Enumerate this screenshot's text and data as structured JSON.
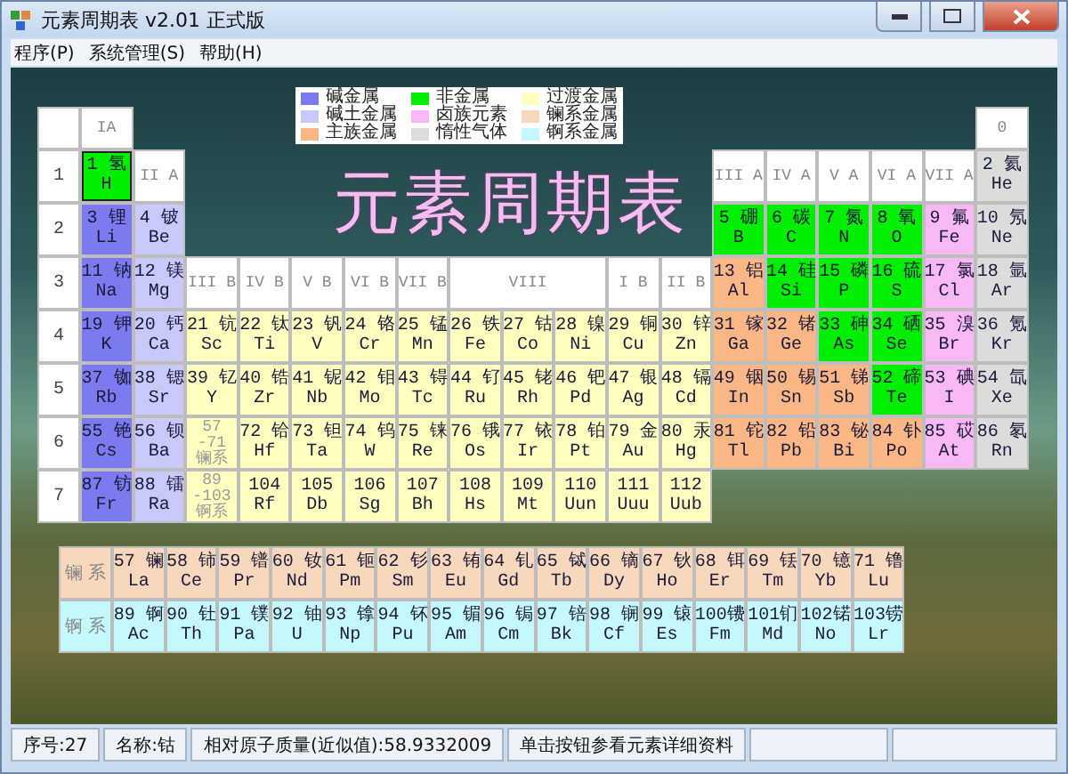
{
  "window": {
    "title": "元素周期表 v2.01 正式版"
  },
  "menu": [
    "程序(P)",
    "系统管理(S)",
    "帮助(H)"
  ],
  "legend": [
    {
      "label": "碱金属",
      "kind": "alkali",
      "color": "#7b7bef"
    },
    {
      "label": "碱土金属",
      "kind": "alkaline",
      "color": "#c8c8fa"
    },
    {
      "label": "主族金属",
      "kind": "poor",
      "color": "#fbb685"
    },
    {
      "label": "非金属",
      "kind": "nonmetal",
      "color": "#00ee00"
    },
    {
      "label": "卤族元素",
      "kind": "halogen",
      "color": "#f8b8f4"
    },
    {
      "label": "惰性气体",
      "kind": "noble",
      "color": "#dcdcdc"
    },
    {
      "label": "过渡金属",
      "kind": "transition",
      "color": "#ffffc0"
    },
    {
      "label": "镧系金属",
      "kind": "lanthanide",
      "color": "#f8d8bc"
    },
    {
      "label": "锕系金属",
      "kind": "actinide",
      "color": "#c4f8fa"
    }
  ],
  "title": "元素周期表",
  "group_headers_a": [
    "IA",
    "II A",
    "III A",
    "IV A",
    "V A",
    "VI A",
    "VII A",
    "0"
  ],
  "group_headers_b": [
    "III B",
    "IV B",
    "V B",
    "VI B",
    "VII B",
    "VIII",
    "I B",
    "II B"
  ],
  "periods": [
    "1",
    "2",
    "3",
    "4",
    "5",
    "6",
    "7"
  ],
  "rows": [
    [
      {
        "label": "1 氢",
        "sym": "H",
        "kind": "nonmetal",
        "focused": true
      },
      {
        "label": "2 氦",
        "sym": "He",
        "kind": "noble",
        "focused": false
      }
    ],
    [
      {
        "label": "3 锂",
        "sym": "Li",
        "kind": "alkali",
        "focused": false
      },
      {
        "label": "4 铍",
        "sym": "Be",
        "kind": "alkaline",
        "focused": false
      },
      {
        "label": "5 硼",
        "sym": "B",
        "kind": "nonmetal",
        "focused": false
      },
      {
        "label": "6 碳",
        "sym": "C",
        "kind": "nonmetal",
        "focused": false
      },
      {
        "label": "7 氮",
        "sym": "N",
        "kind": "nonmetal",
        "focused": false
      },
      {
        "label": "8 氧",
        "sym": "O",
        "kind": "nonmetal",
        "focused": false
      },
      {
        "label": "9 氟",
        "sym": "Fe",
        "kind": "halogen",
        "focused": false
      },
      {
        "label": "10 氖",
        "sym": "Ne",
        "kind": "noble",
        "focused": false
      }
    ],
    [
      {
        "label": "11 钠",
        "sym": "Na",
        "kind": "alkali",
        "focused": false
      },
      {
        "label": "12 镁",
        "sym": "Mg",
        "kind": "alkaline",
        "focused": false
      },
      {
        "label": "13 铝",
        "sym": "Al",
        "kind": "poor",
        "focused": false
      },
      {
        "label": "14 硅",
        "sym": "Si",
        "kind": "nonmetal",
        "focused": false
      },
      {
        "label": "15 磷",
        "sym": "P",
        "kind": "nonmetal",
        "focused": false
      },
      {
        "label": "16 硫",
        "sym": "S",
        "kind": "nonmetal",
        "focused": false
      },
      {
        "label": "17 氯",
        "sym": "Cl",
        "kind": "halogen",
        "focused": false
      },
      {
        "label": "18 氩",
        "sym": "Ar",
        "kind": "noble",
        "focused": false
      }
    ],
    [
      {
        "label": "19 钾",
        "sym": "K",
        "kind": "alkali",
        "focused": false
      },
      {
        "label": "20 钙",
        "sym": "Ca",
        "kind": "alkaline",
        "focused": false
      },
      {
        "label": "21 钪",
        "sym": "Sc",
        "kind": "transition",
        "focused": false
      },
      {
        "label": "22 钛",
        "sym": "Ti",
        "kind": "transition",
        "focused": false
      },
      {
        "label": "23 钒",
        "sym": "V",
        "kind": "transition",
        "focused": false
      },
      {
        "label": "24 铬",
        "sym": "Cr",
        "kind": "transition",
        "focused": false
      },
      {
        "label": "25 锰",
        "sym": "Mn",
        "kind": "transition",
        "focused": false
      },
      {
        "label": "26 铁",
        "sym": "Fe",
        "kind": "transition",
        "focused": false
      },
      {
        "label": "27 钴",
        "sym": "Co",
        "kind": "transition",
        "focused": false
      },
      {
        "label": "28 镍",
        "sym": "Ni",
        "kind": "transition",
        "focused": false
      },
      {
        "label": "29 铜",
        "sym": "Cu",
        "kind": "transition",
        "focused": false
      },
      {
        "label": "30 锌",
        "sym": "Zn",
        "kind": "transition",
        "focused": false
      },
      {
        "label": "31 镓",
        "sym": "Ga",
        "kind": "poor",
        "focused": false
      },
      {
        "label": "32 锗",
        "sym": "Ge",
        "kind": "poor",
        "focused": false
      },
      {
        "label": "33 砷",
        "sym": "As",
        "kind": "nonmetal",
        "focused": false
      },
      {
        "label": "34 硒",
        "sym": "Se",
        "kind": "nonmetal",
        "focused": false
      },
      {
        "label": "35 溴",
        "sym": "Br",
        "kind": "halogen",
        "focused": false
      },
      {
        "label": "36 氪",
        "sym": "Kr",
        "kind": "noble",
        "focused": false
      }
    ],
    [
      {
        "label": "37 铷",
        "sym": "Rb",
        "kind": "alkali",
        "focused": false
      },
      {
        "label": "38 锶",
        "sym": "Sr",
        "kind": "alkaline",
        "focused": false
      },
      {
        "label": "39 钇",
        "sym": "Y",
        "kind": "transition",
        "focused": false
      },
      {
        "label": "40 锆",
        "sym": "Zr",
        "kind": "transition",
        "focused": false
      },
      {
        "label": "41 铌",
        "sym": "Nb",
        "kind": "transition",
        "focused": false
      },
      {
        "label": "42 钼",
        "sym": "Mo",
        "kind": "transition",
        "focused": false
      },
      {
        "label": "43 锝",
        "sym": "Tc",
        "kind": "transition",
        "focused": false
      },
      {
        "label": "44 钌",
        "sym": "Ru",
        "kind": "transition",
        "focused": false
      },
      {
        "label": "45 铑",
        "sym": "Rh",
        "kind": "transition",
        "focused": false
      },
      {
        "label": "46 钯",
        "sym": "Pd",
        "kind": "transition",
        "focused": false
      },
      {
        "label": "47 银",
        "sym": "Ag",
        "kind": "transition",
        "focused": false
      },
      {
        "label": "48 镉",
        "sym": "Cd",
        "kind": "transition",
        "focused": false
      },
      {
        "label": "49 铟",
        "sym": "In",
        "kind": "poor",
        "focused": false
      },
      {
        "label": "50 锡",
        "sym": "Sn",
        "kind": "poor",
        "focused": false
      },
      {
        "label": "51 锑",
        "sym": "Sb",
        "kind": "poor",
        "focused": false
      },
      {
        "label": "52 碲",
        "sym": "Te",
        "kind": "nonmetal",
        "focused": false
      },
      {
        "label": "53 碘",
        "sym": "I",
        "kind": "halogen",
        "focused": false
      },
      {
        "label": "54 氙",
        "sym": "Xe",
        "kind": "noble",
        "focused": false
      }
    ],
    [
      {
        "label": "55 铯",
        "sym": "Cs",
        "kind": "alkali",
        "focused": false
      },
      {
        "label": "56 钡",
        "sym": "Ba",
        "kind": "alkaline",
        "focused": false
      },
      {
        "kind": "series",
        "lines": [
          "57",
          "-71",
          "镧系"
        ]
      },
      {
        "label": "72 铪",
        "sym": "Hf",
        "kind": "transition",
        "focused": false
      },
      {
        "label": "73 钽",
        "sym": "Ta",
        "kind": "transition",
        "focused": false
      },
      {
        "label": "74 钨",
        "sym": "W",
        "kind": "transition",
        "focused": false
      },
      {
        "label": "75 铼",
        "sym": "Re",
        "kind": "transition",
        "focused": false
      },
      {
        "label": "76 锇",
        "sym": "Os",
        "kind": "transition",
        "focused": false
      },
      {
        "label": "77 铱",
        "sym": "Ir",
        "kind": "transition",
        "focused": false
      },
      {
        "label": "78 铂",
        "sym": "Pt",
        "kind": "transition",
        "focused": false
      },
      {
        "label": "79 金",
        "sym": "Au",
        "kind": "transition",
        "focused": false
      },
      {
        "label": "80 汞",
        "sym": "Hg",
        "kind": "transition",
        "focused": false
      },
      {
        "label": "81 铊",
        "sym": "Tl",
        "kind": "poor",
        "focused": false
      },
      {
        "label": "82 铅",
        "sym": "Pb",
        "kind": "poor",
        "focused": false
      },
      {
        "label": "83 铋",
        "sym": "Bi",
        "kind": "poor",
        "focused": false
      },
      {
        "label": "84 钋",
        "sym": "Po",
        "kind": "poor",
        "focused": false
      },
      {
        "label": "85 砹",
        "sym": "At",
        "kind": "halogen",
        "focused": false
      },
      {
        "label": "86 氡",
        "sym": "Rn",
        "kind": "noble",
        "focused": false
      }
    ],
    [
      {
        "label": "87 钫",
        "sym": "Fr",
        "kind": "alkali",
        "focused": false
      },
      {
        "label": "88 镭",
        "sym": "Ra",
        "kind": "alkaline",
        "focused": false
      },
      {
        "kind": "series",
        "lines": [
          "89",
          "-103",
          "锕系"
        ]
      },
      {
        "label": "104",
        "sym": "Rf",
        "kind": "transition",
        "focused": false
      },
      {
        "label": "105",
        "sym": "Db",
        "kind": "transition",
        "focused": false
      },
      {
        "label": "106",
        "sym": "Sg",
        "kind": "transition",
        "focused": false
      },
      {
        "label": "107",
        "sym": "Bh",
        "kind": "transition",
        "focused": false
      },
      {
        "label": "108",
        "sym": "Hs",
        "kind": "transition",
        "focused": false
      },
      {
        "label": "109",
        "sym": "Mt",
        "kind": "transition",
        "focused": false
      },
      {
        "label": "110",
        "sym": "Uun",
        "kind": "transition",
        "focused": false
      },
      {
        "label": "111",
        "sym": "Uuu",
        "kind": "transition",
        "focused": false
      },
      {
        "label": "112",
        "sym": "Uub",
        "kind": "transition",
        "focused": false
      }
    ]
  ],
  "series": [
    {
      "label": "镧 系",
      "kind": "lanthanide",
      "elements": [
        {
          "label": "57 镧",
          "sym": "La"
        },
        {
          "label": "58 铈",
          "sym": "Ce"
        },
        {
          "label": "59 镨",
          "sym": "Pr"
        },
        {
          "label": "60 钕",
          "sym": "Nd"
        },
        {
          "label": "61 钷",
          "sym": "Pm"
        },
        {
          "label": "62 钐",
          "sym": "Sm"
        },
        {
          "label": "63 铕",
          "sym": "Eu"
        },
        {
          "label": "64 钆",
          "sym": "Gd"
        },
        {
          "label": "65 铽",
          "sym": "Tb"
        },
        {
          "label": "66 镝",
          "sym": "Dy"
        },
        {
          "label": "67 钬",
          "sym": "Ho"
        },
        {
          "label": "68 铒",
          "sym": "Er"
        },
        {
          "label": "69 铥",
          "sym": "Tm"
        },
        {
          "label": "70 镱",
          "sym": "Yb"
        },
        {
          "label": "71 镥",
          "sym": "Lu"
        }
      ]
    },
    {
      "label": "锕 系",
      "kind": "actinide",
      "elements": [
        {
          "label": "89 锕",
          "sym": "Ac"
        },
        {
          "label": "90 钍",
          "sym": "Th"
        },
        {
          "label": "91 镤",
          "sym": "Pa"
        },
        {
          "label": "92 铀",
          "sym": "U"
        },
        {
          "label": "93 镎",
          "sym": "Np"
        },
        {
          "label": "94 钚",
          "sym": "Pu"
        },
        {
          "label": "95 镅",
          "sym": "Am"
        },
        {
          "label": "96 锔",
          "sym": "Cm"
        },
        {
          "label": "97 锫",
          "sym": "Bk"
        },
        {
          "label": "98 锎",
          "sym": "Cf"
        },
        {
          "label": "99 锿",
          "sym": "Es"
        },
        {
          "label": "100镄",
          "sym": "Fm"
        },
        {
          "label": "101钔",
          "sym": "Md"
        },
        {
          "label": "102锘",
          "sym": "No"
        },
        {
          "label": "103铹",
          "sym": "Lr"
        }
      ]
    }
  ],
  "status_bar": [
    "序号:27",
    "名称:钴",
    "相对原子质量(近似值):58.9332009",
    "单击按钮参看元素详细资料"
  ]
}
